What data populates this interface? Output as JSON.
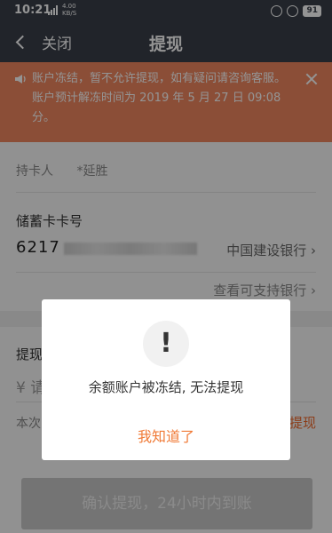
{
  "status_bar": {
    "time": "10:21",
    "speed": "4.00",
    "speed_unit": "KB/S",
    "battery": "91"
  },
  "nav": {
    "back_label": "关闭",
    "title": "提现"
  },
  "notice": {
    "line1": "账户冻结，暂不允许提现，如有疑问请咨询客服。",
    "line2": "账户预计解冻时间为 2019 年 5 月 27 日 09:08",
    "line3": "分。"
  },
  "form": {
    "holder_label": "持卡人",
    "holder_name": "*延胜",
    "card_label": "储蓄卡卡号",
    "card_prefix": "6217",
    "bank_name": "中国建设银行",
    "supported_banks_link": "查看可支持银行",
    "amount_label": "提现",
    "amount_prefix": "¥ 请",
    "fee_label": "本次",
    "withdraw_all": "提现"
  },
  "confirm_button": "确认提现，24小时内到账",
  "dialog": {
    "icon": "!",
    "message": "余额账户被冻结, 无法提现",
    "ok_button": "我知道了"
  },
  "colors": {
    "header": "#3a3f49",
    "notice_bg": "#f0875f",
    "accent": "#f07a36"
  }
}
